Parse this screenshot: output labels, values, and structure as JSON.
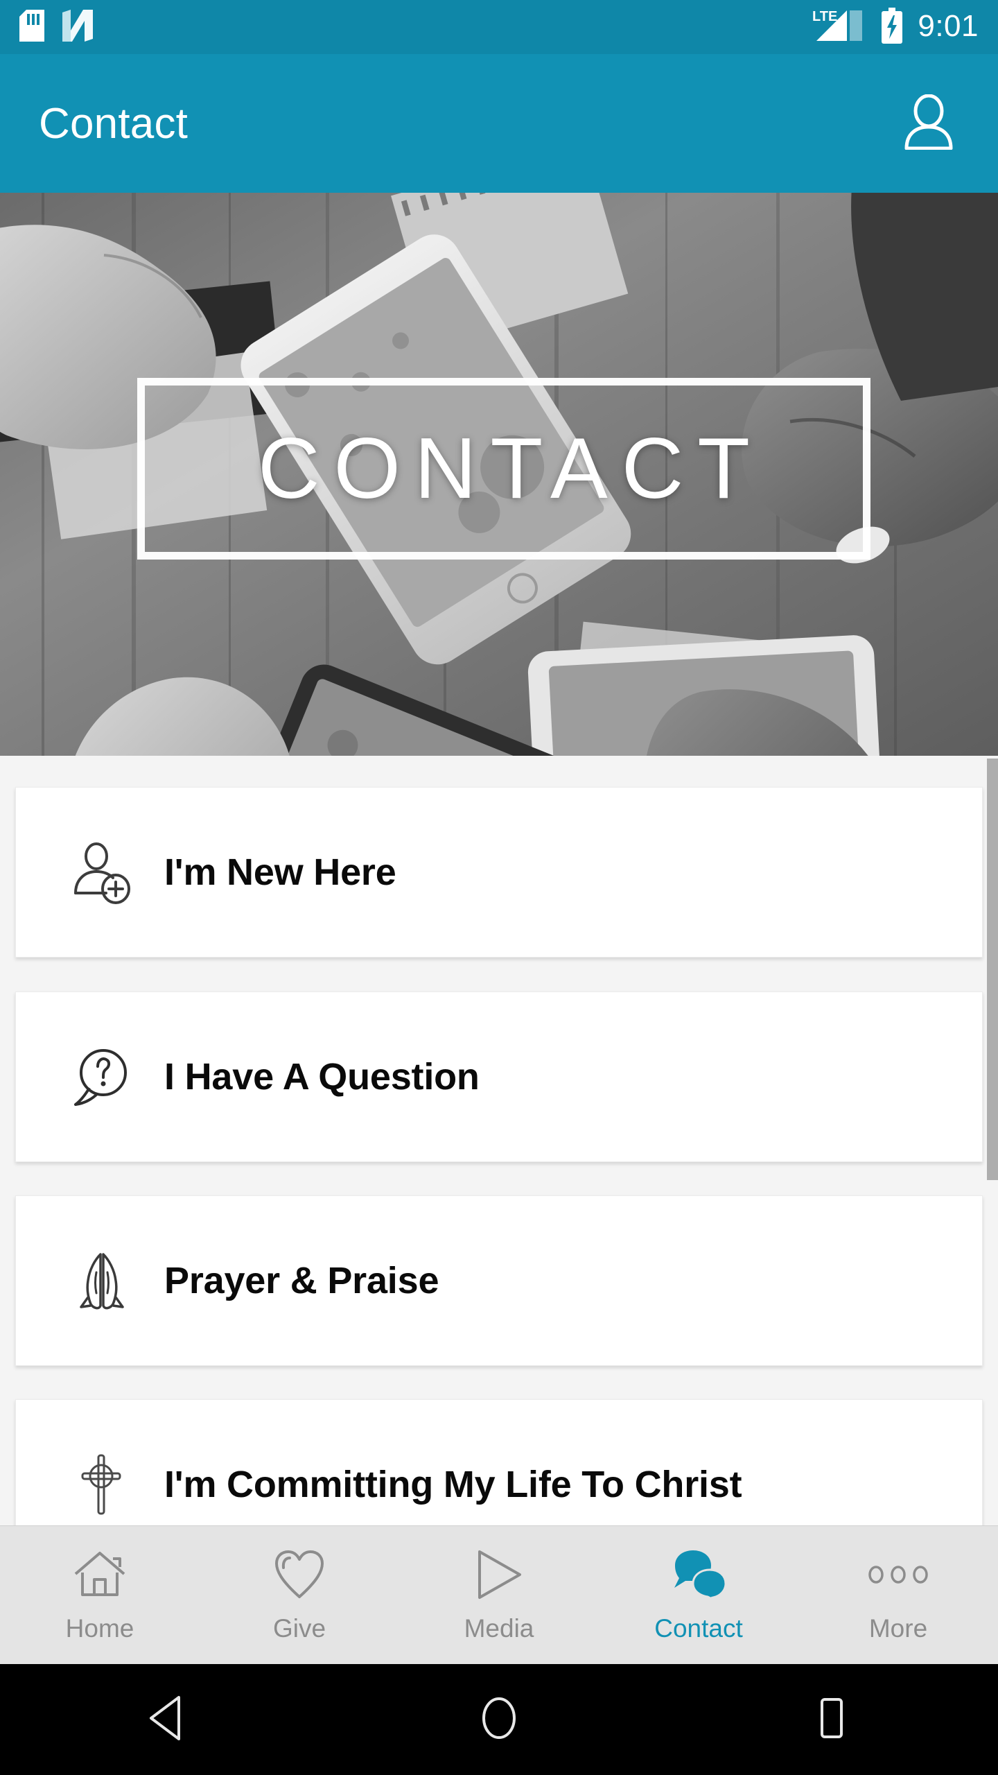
{
  "status_bar": {
    "network_label": "LTE",
    "clock": "9:01",
    "icons": [
      "sd-card-icon",
      "nfc-icon",
      "signal-icon",
      "battery-charging-icon"
    ],
    "background_color": "#0f87a8"
  },
  "app_bar": {
    "title": "Contact",
    "action_icon": "person-icon",
    "background_color": "#1191b4",
    "text_color": "#ffffff"
  },
  "hero": {
    "overlay_text": "CONTACT",
    "image_description": "grayscale photo of several hands holding smartphones above a wooden table"
  },
  "list": {
    "items": [
      {
        "label": "I'm New Here",
        "icon": "person-add-icon"
      },
      {
        "label": "I Have A Question",
        "icon": "question-bubble-icon"
      },
      {
        "label": "Prayer & Praise",
        "icon": "praying-hands-icon"
      },
      {
        "label": "I'm Committing My Life To Christ",
        "icon": "cross-icon"
      }
    ]
  },
  "tab_bar": {
    "active_color": "#1191b4",
    "inactive_color": "#8c8c8c",
    "tabs": [
      {
        "label": "Home",
        "icon": "home-icon",
        "active": false
      },
      {
        "label": "Give",
        "icon": "heart-icon",
        "active": false
      },
      {
        "label": "Media",
        "icon": "play-icon",
        "active": false
      },
      {
        "label": "Contact",
        "icon": "chat-bubbles-icon",
        "active": true
      },
      {
        "label": "More",
        "icon": "more-dots-icon",
        "active": false
      }
    ]
  },
  "system_nav": {
    "buttons": [
      {
        "name": "back-button",
        "icon": "triangle-back-icon"
      },
      {
        "name": "home-button",
        "icon": "circle-home-icon"
      },
      {
        "name": "recents-button",
        "icon": "square-recents-icon"
      }
    ]
  }
}
